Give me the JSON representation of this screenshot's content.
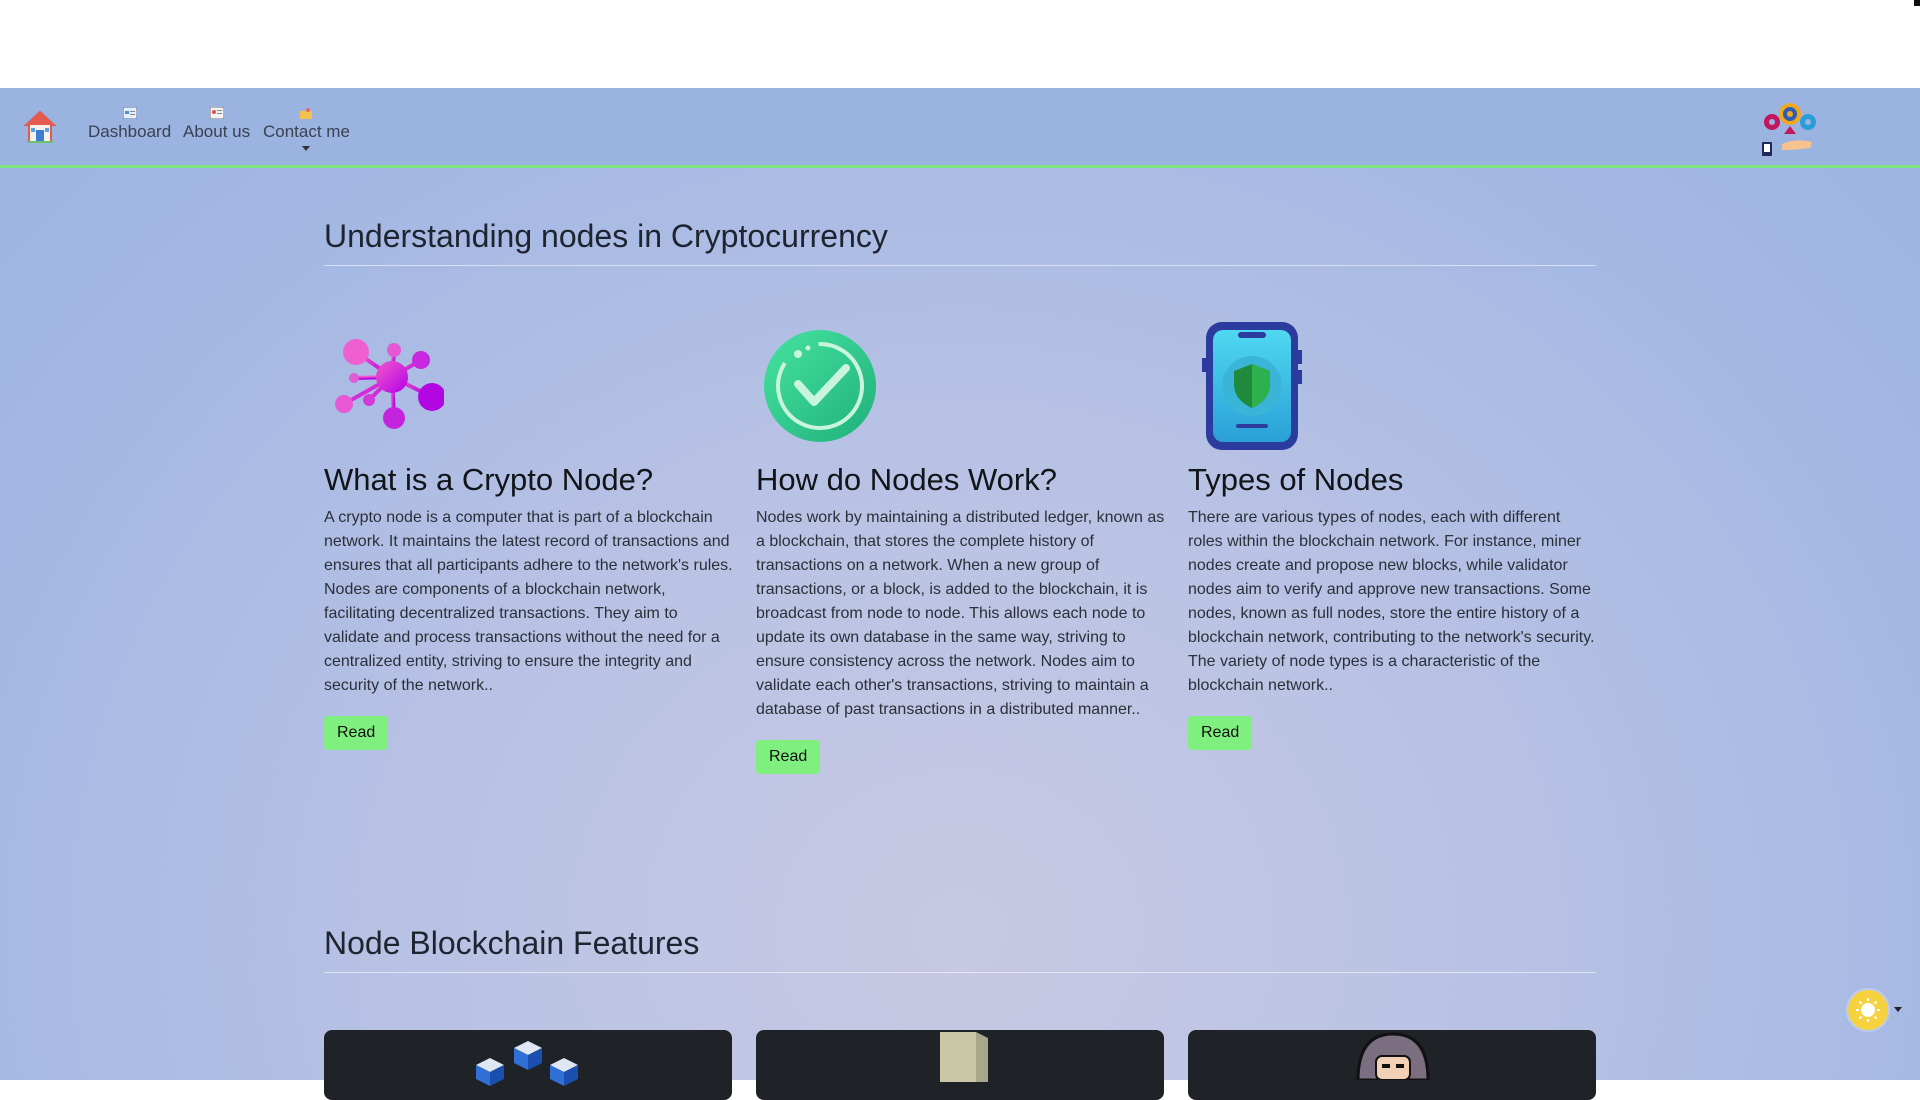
{
  "navbar": {
    "home_icon": "home-icon",
    "items": [
      {
        "label": "Dashboard",
        "icon": "dashboard-icon"
      },
      {
        "label": "About us",
        "icon": "about-icon"
      },
      {
        "label": "Contact me",
        "icon": "contact-icon"
      }
    ],
    "logo_icon": "gears-hand-logo"
  },
  "section1": {
    "title": "Understanding nodes in Cryptocurrency",
    "cards": [
      {
        "icon": "network-nodes-icon",
        "heading": "What is a Crypto Node?",
        "body": "A crypto node is a computer that is part of a blockchain network. It maintains the latest record of transactions and ensures that all participants adhere to the network's rules. Nodes are components of a blockchain network, facilitating decentralized transactions. They aim to validate and process transactions without the need for a centralized entity, striving to ensure the integrity and security of the network..",
        "button": "Read"
      },
      {
        "icon": "checkmark-circle-icon",
        "heading": "How do Nodes Work?",
        "body": "Nodes work by maintaining a distributed ledger, known as a blockchain, that stores the complete history of transactions on a network. When a new group of transactions, or a block, is added to the blockchain, it is broadcast from node to node. This allows each node to update its own database in the same way, striving to ensure consistency across the network. Nodes aim to validate each other's transactions, striving to maintain a database of past transactions in a distributed manner..",
        "button": "Read"
      },
      {
        "icon": "phone-shield-icon",
        "heading": "Types of Nodes",
        "body": "There are various types of nodes, each with different roles within the blockchain network. For instance, miner nodes create and propose new blocks, while validator nodes aim to verify and approve new transactions. Some nodes, known as full nodes, store the entire history of a blockchain network, contributing to the network's security. The variety of node types is a characteristic of the blockchain network..",
        "button": "Read"
      }
    ]
  },
  "section2": {
    "title": "Node Blockchain Features",
    "cards": [
      {
        "icon": "cubes-icon"
      },
      {
        "icon": "server-icon"
      },
      {
        "icon": "hacker-icon"
      }
    ]
  },
  "theme_toggle": {
    "icon": "sun-icon"
  },
  "colors": {
    "navbar_bg": "#9bb3e1",
    "navbar_border": "#7fe27f",
    "read_button": "#7ff07f",
    "feature_card": "#1f2226",
    "theme_toggle": "#f5d23e"
  }
}
